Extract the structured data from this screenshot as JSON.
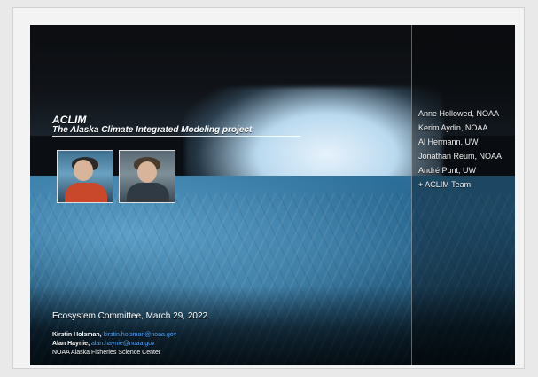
{
  "slide": {
    "title": "ACLIM",
    "subtitle": "The Alaska Climate Integrated Modeling project",
    "credits": [
      "Anne Hollowed, NOAA",
      "Kerim Aydin, NOAA",
      "Al Hermann, UW",
      "Jonathan Reum, NOAA",
      "André Punt, UW",
      "+ ACLIM Team"
    ],
    "meeting": "Ecosystem Committee, March 29, 2022",
    "contacts": [
      {
        "name": "Kirstin Holsman,",
        "email": "kirstin.holsman@noaa.gov"
      },
      {
        "name": "Alan Haynie,",
        "email": "alan.haynie@noaa.gov"
      }
    ],
    "org": "NOAA Alaska Fisheries Science Center"
  },
  "colors": {
    "background": "#e9e9e9",
    "frame": "#f3f3f3",
    "link": "#4da3ff",
    "text": "#ffffff"
  },
  "icons": {
    "photo_1": "person-photo",
    "photo_2": "person-photo"
  }
}
